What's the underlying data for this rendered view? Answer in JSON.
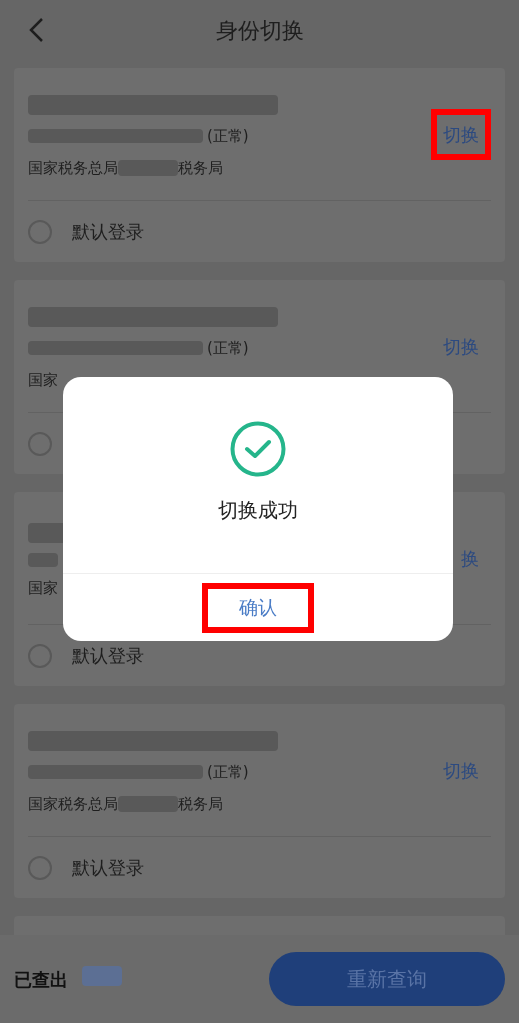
{
  "header": {
    "title": "身份切换"
  },
  "cards": [
    {
      "status": "(正常)",
      "org": [
        "国家税务总局",
        "税务局"
      ],
      "switch": {
        "label": "切换",
        "highlighted": true
      },
      "default_login": {
        "label": "默认登录",
        "checked": false
      }
    },
    {
      "status": "(正常)",
      "org": [
        "国家"
      ],
      "switch": {
        "label": "切换",
        "highlighted": false
      },
      "default_login": {
        "checked": false
      }
    },
    {
      "org": [
        "国家"
      ],
      "switch": {
        "label": "换",
        "highlighted": false
      },
      "default_login": {
        "label": "默认登录",
        "checked": false
      }
    },
    {
      "status": "(正常)",
      "org": [
        "国家税务总局",
        "税务局"
      ],
      "switch": {
        "label": "切换",
        "highlighted": false
      },
      "default_login": {
        "label": "默认登录",
        "checked": false
      }
    }
  ],
  "footer": {
    "found_label": "已查出",
    "button": "重新查询"
  },
  "dialog": {
    "message": "切换成功",
    "confirm": {
      "label": "确认",
      "highlighted": true
    }
  }
}
